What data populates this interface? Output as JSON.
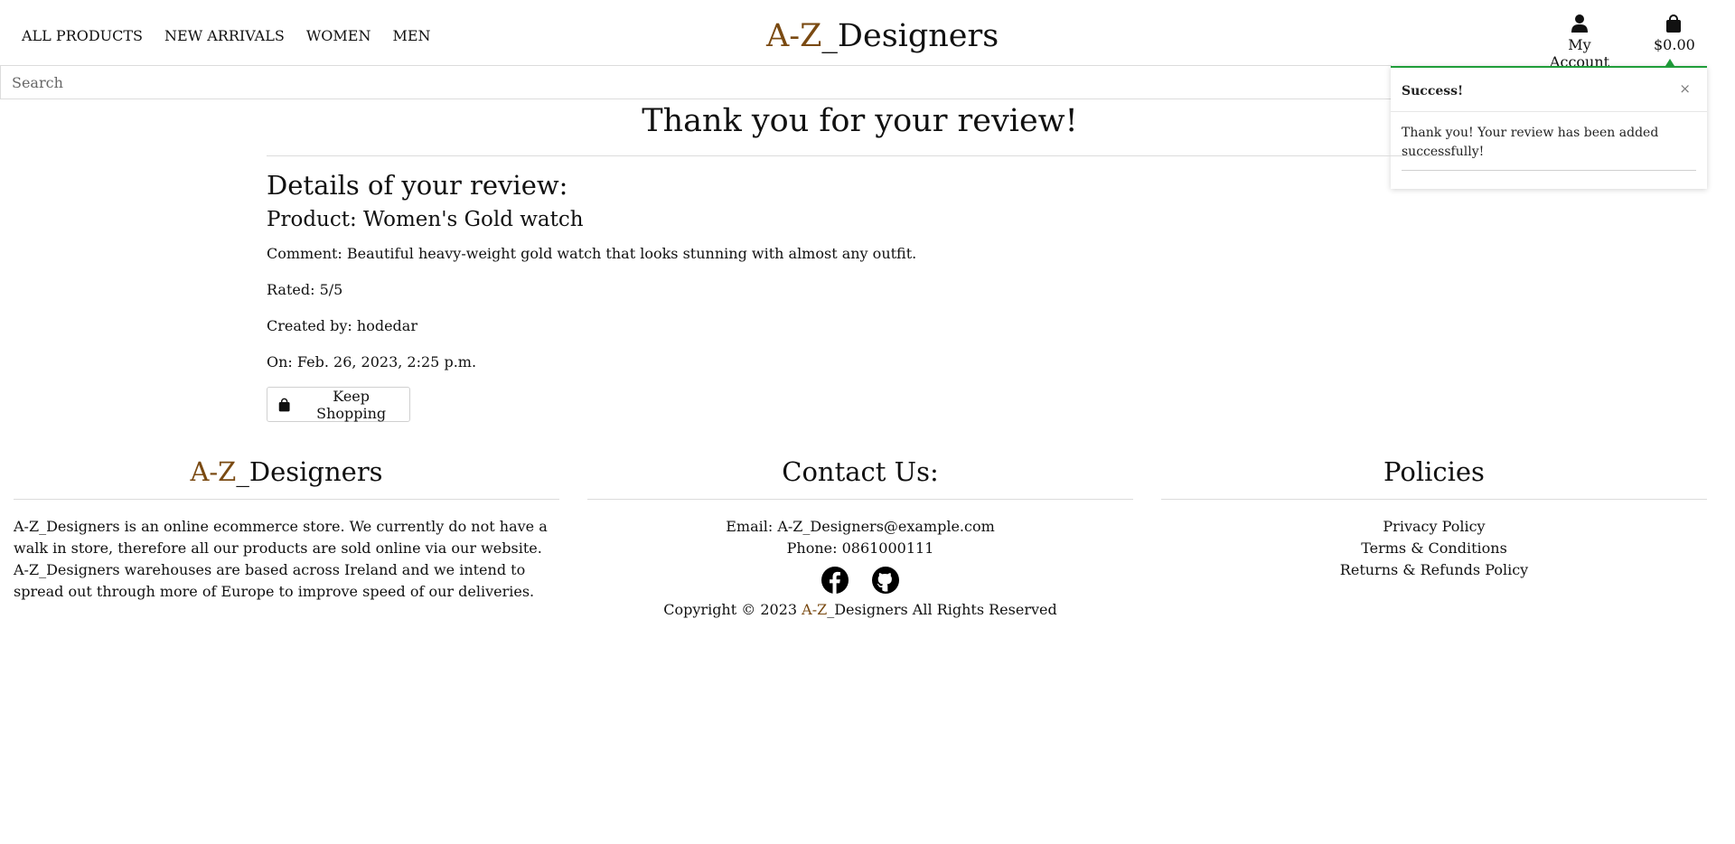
{
  "nav": {
    "items": [
      "ALL PRODUCTS",
      "NEW ARRIVALS",
      "WOMEN",
      "MEN"
    ]
  },
  "logo": {
    "az": "A-Z",
    "rest": "_Designers"
  },
  "account": {
    "label": "My Account",
    "icon": "user-icon"
  },
  "bag": {
    "total": "$0.00",
    "icon": "shopping-bag-icon"
  },
  "search": {
    "placeholder": "Search"
  },
  "toast": {
    "title": "Success!",
    "close": "×",
    "message": "Thank you! Your review has been added successfully!",
    "accent": "#1f9d3a"
  },
  "main": {
    "title": "Thank you for your review!",
    "details_heading": "Details of your review:",
    "product": "Product: Women's Gold watch",
    "comment": "Comment: Beautiful heavy-weight gold watch that looks stunning with almost any outfit.",
    "rated": "Rated: 5/5",
    "created_by": "Created by: hodedar",
    "on": "On: Feb. 26, 2023, 2:25 p.m.",
    "keep_shopping": "Keep Shopping"
  },
  "footer": {
    "about": {
      "title_az": "A-Z",
      "title_rest": "_Designers",
      "text": "A-Z_Designers is an online ecommerce store. We currently do not have a walk in store, therefore all our products are sold online via our website. A-Z_Designers warehouses are based across Ireland and we intend to spread out through more of Europe to improve speed of our deliveries."
    },
    "contact": {
      "title": "Contact Us:",
      "email": "Email: A-Z_Designers@example.com",
      "phone": "Phone: 0861000111",
      "socials": [
        "facebook-icon",
        "github-icon"
      ],
      "copyright_pre": "Copyright © 2023 ",
      "copyright_az": "A-Z",
      "copyright_brand": "_Designers",
      "copyright_post": " All Rights Reserved"
    },
    "policies": {
      "title": "Policies",
      "links": [
        "Privacy Policy",
        "Terms & Conditions",
        "Returns & Refunds Policy"
      ]
    }
  },
  "colors": {
    "brand": "#7a4a12",
    "success": "#1f9d3a"
  }
}
